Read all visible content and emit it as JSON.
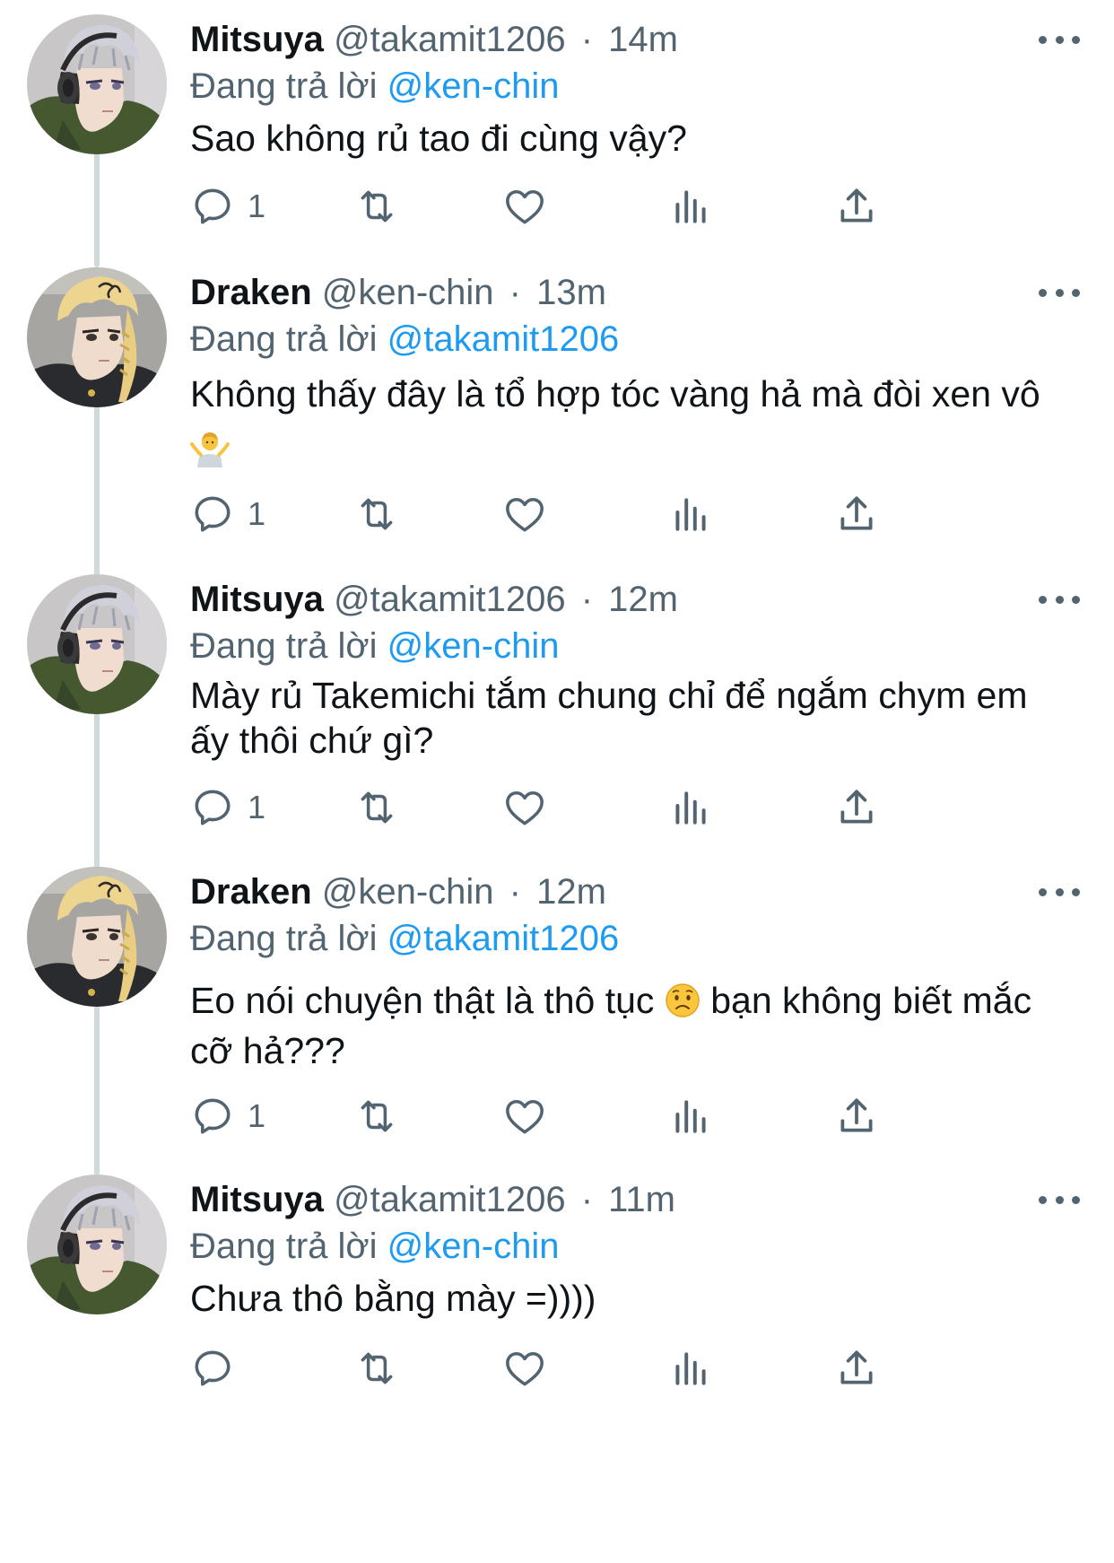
{
  "labels": {
    "replying_prefix": "Đang trả lời",
    "more_icon": "more-horizontal-icon",
    "reply_icon": "reply-icon",
    "retweet_icon": "retweet-icon",
    "like_icon": "like-heart-icon",
    "views_icon": "views-bar-chart-icon",
    "share_icon": "share-upload-icon"
  },
  "colors": {
    "text": "#0f1419",
    "secondary": "#536471",
    "link": "#1d9bf0",
    "thread_line": "#cfd9de"
  },
  "tweets": [
    {
      "name": "Mitsuya",
      "handle": "@takamit1206",
      "dot": "·",
      "time": "14m",
      "replying_to": "@ken-chin",
      "text": "Sao không rủ tao đi cùng vậy?",
      "emoji": "",
      "reply_count": "1",
      "avatar": "mitsuya-avatar"
    },
    {
      "name": "Draken",
      "handle": "@ken-chin",
      "dot": "·",
      "time": "13m",
      "replying_to": "@takamit1206",
      "text": "Không thấy đây là tổ hợp tóc vàng hả mà đòi xen vô",
      "emoji": "🤷‍♂️",
      "reply_count": "1",
      "avatar": "draken-avatar"
    },
    {
      "name": "Mitsuya",
      "handle": "@takamit1206",
      "dot": "·",
      "time": "12m",
      "replying_to": "@ken-chin",
      "text": "Mày rủ Takemichi tắm chung chỉ để ngắm chym em ấy thôi chứ gì?",
      "emoji": "",
      "reply_count": "1",
      "avatar": "mitsuya-avatar"
    },
    {
      "name": "Draken",
      "handle": "@ken-chin",
      "dot": "·",
      "time": "12m",
      "replying_to": "@takamit1206",
      "text_before": "Eo nói chuyện thật là thô tục",
      "emoji": "😟",
      "text_after": "bạn không biết mắc cỡ hả???",
      "reply_count": "1",
      "avatar": "draken-avatar"
    },
    {
      "name": "Mitsuya",
      "handle": "@takamit1206",
      "dot": "·",
      "time": "11m",
      "replying_to": "@ken-chin",
      "text": "Chưa thô bằng mày =))))",
      "emoji": "",
      "reply_count": "",
      "avatar": "mitsuya-avatar"
    }
  ]
}
